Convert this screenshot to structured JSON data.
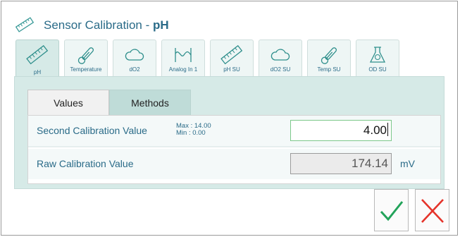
{
  "window": {
    "title_prefix": "Sensor Calibration - ",
    "title_unit": "pH",
    "title_icon": "ruler-icon"
  },
  "sensor_tabs": [
    {
      "label": "pH",
      "icon": "ruler-icon",
      "active": true
    },
    {
      "label": "Temperature",
      "icon": "thermometer-icon",
      "active": false
    },
    {
      "label": "dO2",
      "icon": "cloud-icon",
      "active": false
    },
    {
      "label": "Analog In 1",
      "icon": "signal-icon",
      "active": false
    },
    {
      "label": "pH SU",
      "icon": "ruler-icon",
      "active": false
    },
    {
      "label": "dO2 SU",
      "icon": "cloud-icon",
      "active": false
    },
    {
      "label": "Temp SU",
      "icon": "thermometer-icon",
      "active": false
    },
    {
      "label": "OD SU",
      "icon": "flask-icon",
      "active": false
    }
  ],
  "subtabs": {
    "values": "Values",
    "methods": "Methods",
    "active": "Methods"
  },
  "rows": {
    "second_calibration": {
      "label": "Second Calibration Value",
      "max": "Max : 14.00",
      "min": "Min : 0.00",
      "value": "4.00"
    },
    "raw_calibration": {
      "label": "Raw Calibration Value",
      "value": "174.14",
      "unit": "mV"
    }
  },
  "buttons": {
    "ok_icon": "checkmark-icon",
    "cancel_icon": "close-icon"
  },
  "colors": {
    "accent_text": "#2a6b88",
    "panel_bg": "#d6eae7",
    "ok_green": "#22a35a",
    "cancel_red": "#e5332a"
  }
}
